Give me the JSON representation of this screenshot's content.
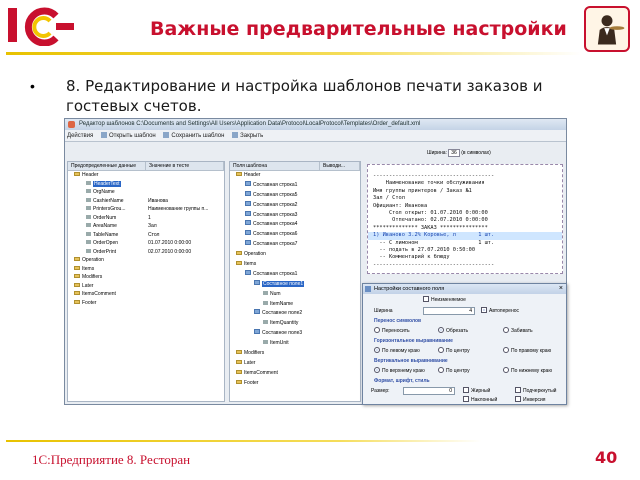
{
  "slide": {
    "logo_text": "1С",
    "title": "Важные предварительные настройки",
    "bullet": "•",
    "item": "8. Редактирование и настройка шаблонов печати заказов и гостевых счетов.",
    "footer": "1С:Предприятие 8. Ресторан",
    "page_number": "40",
    "accent": "#c8102e"
  },
  "app": {
    "title": "Редактор шаблонов C:\\Documents and Settings\\All Users\\Application Data\\Protocol\\LocalProtocol\\Templates\\Order_default.xml",
    "toolbar": [
      "Действия",
      "Открыть шаблон",
      "Сохранить шаблон",
      "Закрыть"
    ],
    "left_panel": {
      "headers": [
        "Предопределенные данные",
        "Значение в тесте"
      ],
      "rows": [
        {
          "name": "Header",
          "value": "",
          "type": "folder",
          "level": 0
        },
        {
          "name": "HeaderText",
          "value": "",
          "type": "field",
          "level": 1,
          "selected": true
        },
        {
          "name": "OrgName",
          "value": "",
          "type": "field",
          "level": 1
        },
        {
          "name": "CashierName",
          "value": "Иванова",
          "type": "field",
          "level": 1
        },
        {
          "name": "PrintersGrou...",
          "value": "Наименование группы п...",
          "type": "field",
          "level": 1
        },
        {
          "name": "OrderNum",
          "value": "1",
          "type": "field",
          "level": 1
        },
        {
          "name": "AreaName",
          "value": "Зал",
          "type": "field",
          "level": 1
        },
        {
          "name": "TableName",
          "value": "Стол",
          "type": "field",
          "level": 1
        },
        {
          "name": "OrderOpen",
          "value": "01.07.2010 0:00:00",
          "type": "field",
          "level": 1
        },
        {
          "name": "OrderPrint",
          "value": "02.07.2010 0:00:00",
          "type": "field",
          "level": 1
        },
        {
          "name": "Operation",
          "value": "",
          "type": "folder",
          "level": 0
        },
        {
          "name": "Items",
          "value": "",
          "type": "folder",
          "level": 0
        },
        {
          "name": "Modifiers",
          "value": "",
          "type": "folder",
          "level": 0
        },
        {
          "name": "Later",
          "value": "",
          "type": "folder",
          "level": 0
        },
        {
          "name": "ItemsComment",
          "value": "",
          "type": "folder",
          "level": 0
        },
        {
          "name": "Footer",
          "value": "",
          "type": "folder",
          "level": 0
        }
      ]
    },
    "mid_panel": {
      "headers": [
        "Поля шаблона",
        "Выводи..."
      ],
      "rows": [
        {
          "name": "Header",
          "level": 0,
          "type": "folder"
        },
        {
          "name": "Составная строка1",
          "level": 1,
          "type": "node"
        },
        {
          "name": "Составная строка5",
          "level": 1,
          "type": "node"
        },
        {
          "name": "Составная строка2",
          "level": 1,
          "type": "node"
        },
        {
          "name": "Составная строка3",
          "level": 1,
          "type": "node"
        },
        {
          "name": "Составная строка4",
          "level": 1,
          "type": "node"
        },
        {
          "name": "Составная строка6",
          "level": 1,
          "type": "node"
        },
        {
          "name": "Составная строка7",
          "level": 1,
          "type": "node"
        },
        {
          "name": "Operation",
          "level": 0,
          "type": "folder"
        },
        {
          "name": "Items",
          "level": 0,
          "type": "folder"
        },
        {
          "name": "Составная строка1",
          "level": 1,
          "type": "node"
        },
        {
          "name": "Составное поле1",
          "level": 2,
          "type": "node",
          "selected": true
        },
        {
          "name": "Num",
          "level": 3,
          "type": "field"
        },
        {
          "name": "ItemName",
          "level": 3,
          "type": "field"
        },
        {
          "name": "Составное поле2",
          "level": 2,
          "type": "node"
        },
        {
          "name": "ItemQuantity",
          "level": 3,
          "type": "field"
        },
        {
          "name": "Составное поле3",
          "level": 2,
          "type": "node"
        },
        {
          "name": "ItemUnit",
          "level": 3,
          "type": "field"
        },
        {
          "name": "Modifiers",
          "level": 0,
          "type": "folder"
        },
        {
          "name": "Later",
          "level": 0,
          "type": "folder"
        },
        {
          "name": "ItemsComment",
          "level": 0,
          "type": "folder"
        },
        {
          "name": "Footer",
          "level": 0,
          "type": "folder"
        }
      ]
    },
    "receipt_controls": {
      "width_label": "Ширина:",
      "width_value": "36",
      "unit": "(в символах)"
    },
    "receipt_lines": [
      "--------------------------------------",
      "    Наименование точки обслуживания",
      "Имя группы принтеров / Заказ №1",
      "Зал / Стол",
      "Официант: Иванова",
      "     Стол открыт: 01.07.2010 0:00:00",
      "      Отпечатано: 02.07.2010 0:00:00",
      "************** ЗАКАЗ ***************",
      "1) Иваново 3.2% Коровье, л       1 шт.",
      "  -- С лимоном                   1 шт.",
      "  -- подать в 27.07.2010 0:50:00",
      "  -- Комментарий к блюду",
      "--------------------------------------"
    ],
    "receipt_highlight_index": 8
  },
  "dialog": {
    "title": "Настройки составного поля",
    "top_check": "Неизменяемое",
    "width_label": "Ширина",
    "width_value": "4",
    "auto_label": "Автоперенос",
    "wrap_section": "Перенос символов",
    "wrap_options": [
      "Переносить",
      "Обрезать",
      "Забивать"
    ],
    "wrap_selected": 1,
    "halign_section": "Горизонтальное выравнивание",
    "halign_options": [
      "По левому краю",
      "По центру",
      "По правому краю"
    ],
    "halign_selected": 0,
    "valign_section": "Вертикальное выравнивание",
    "valign_options": [
      "По верхнему краю",
      "По центру",
      "По нижнему краю"
    ],
    "valign_selected": 0,
    "font_section": "Формат, шрифт, стиль",
    "size_label": "Размер:",
    "size_value": "0",
    "styles": [
      "Жирный",
      "Наклонный",
      "Подчеркнутый",
      "Инверсия"
    ]
  }
}
